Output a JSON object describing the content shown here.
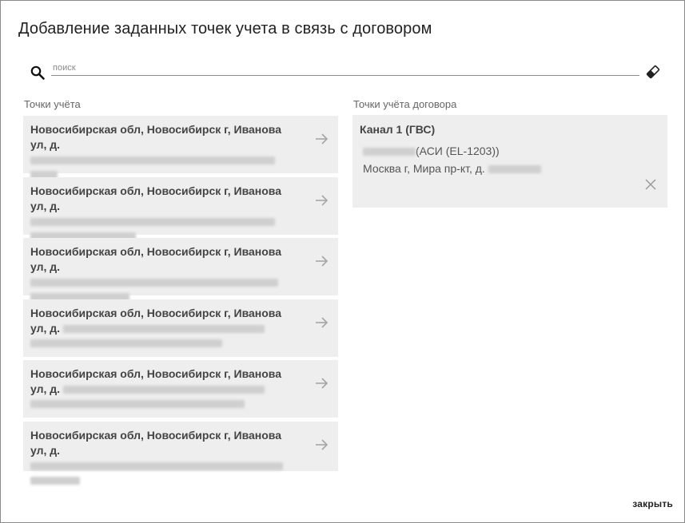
{
  "dialog": {
    "title": "Добавление заданных точек учета в связь с договором",
    "search": {
      "placeholder": "поиск",
      "value": ""
    },
    "close_label": "закрыть"
  },
  "left_column": {
    "label": "Точки учёта",
    "items": [
      {
        "address": "Новосибирская обл, Новосибирск г, Иванова ул, д."
      },
      {
        "address": "Новосибирская обл, Новосибирск г, Иванова ул, д."
      },
      {
        "address": "Новосибирская обл, Новосибирск г, Иванова ул, д."
      },
      {
        "address": "Новосибирская обл, Новосибирск г, Иванова ул, д."
      },
      {
        "address": "Новосибирская обл, Новосибирск г, Иванова ул, д."
      },
      {
        "address": "Новосибирская обл, Новосибирск г, Иванова ул, д."
      }
    ]
  },
  "right_column": {
    "label": "Точки учёта договора",
    "items": [
      {
        "channel": "Канал 1 (ГВС)",
        "device": "(АСИ (EL-1203))",
        "address": "Москва г, Мира пр-кт, д."
      }
    ]
  },
  "colors": {
    "card_bg": "#eeeeee",
    "text_dark": "#444444",
    "label_gray": "#666666",
    "border": "#8a8a8a"
  },
  "icons": [
    "search-icon",
    "eraser-icon",
    "arrow-right-icon",
    "close-icon"
  ]
}
